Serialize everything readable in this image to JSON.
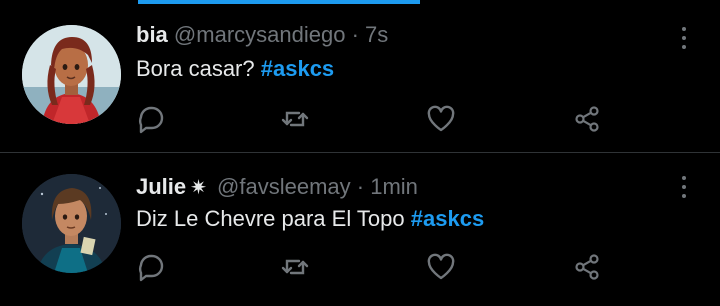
{
  "feed": {
    "tweets": [
      {
        "name": "bia",
        "handle": "@marcysandiego",
        "separator": "·",
        "time": "7s",
        "text": "Bora casar?",
        "hashtag": "#askcs",
        "icons": [
          "reply-icon",
          "retweet-icon",
          "like-icon",
          "share-icon"
        ]
      },
      {
        "name": "Julie",
        "badge": "✷",
        "handle": "@favsleemay",
        "separator": "·",
        "time": "1min",
        "text": "Diz Le Chevre para El Topo",
        "hashtag": "#askcs",
        "icons": [
          "reply-icon",
          "retweet-icon",
          "like-icon",
          "share-icon"
        ]
      }
    ]
  },
  "colors": {
    "background": "#000000",
    "text": "#e7e9ea",
    "muted": "#71767b",
    "accent": "#1d9bf0",
    "divider": "#2f3336"
  }
}
